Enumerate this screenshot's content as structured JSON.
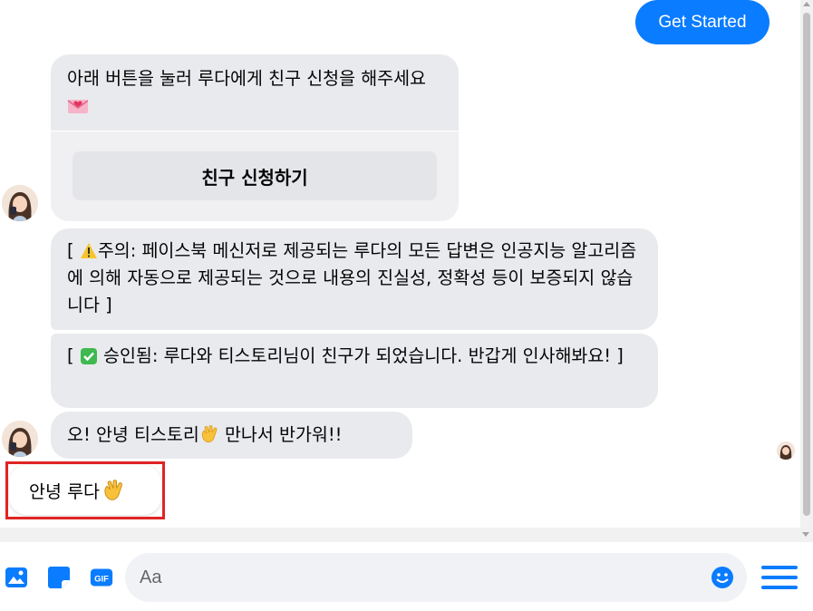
{
  "chat": {
    "get_started": "Get Started",
    "card": {
      "text": "아래 버튼을 눌러 루다에게 친구 신청을 해주세요",
      "text_emoji": "love-letter-icon",
      "button": "친구 신청하기"
    },
    "messages": [
      {
        "text_a": "[ ",
        "emoji": "warning-icon",
        "text_b": "주의: 페이스북 메신저로 제공되는 루다의 모든 답변은 인공지능 알고리즘에 의해 자동으로 제공되는 것으로 내용의 진실성, 정확성 등이 보증되지 않습니다 ]"
      },
      {
        "text_a": "[ ",
        "emoji": "check-mark-icon",
        "text_b": " 승인됨: 루다와 티스토리님이 친구가 되었습니다. 반갑게 인사해봐요! ]"
      },
      {
        "text_a": "오! 안녕 티스토리",
        "emoji": "waving-hand-icon",
        "text_b": " 만나서 반가워!!"
      }
    ],
    "user_message": {
      "text": "안녕 루다",
      "emoji": "waving-hand-icon"
    }
  },
  "composer": {
    "placeholder": "Aa",
    "icons": [
      "image-icon",
      "sticker-icon",
      "gif-icon",
      "emoji-icon",
      "menu-icon"
    ],
    "gif_label": "GIF"
  },
  "colors": {
    "accent": "#0a7cff",
    "bubble": "#e9eaee",
    "highlight": "#e02424"
  }
}
